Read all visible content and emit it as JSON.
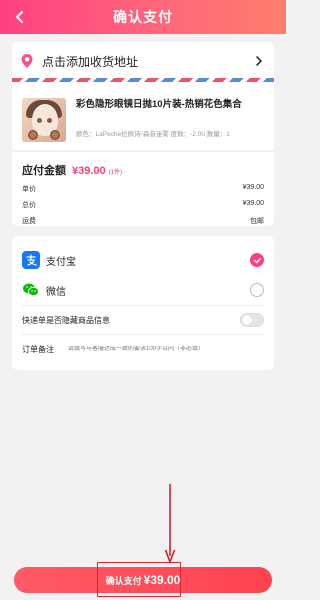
{
  "header": {
    "title": "确认支付"
  },
  "address": {
    "label": "点击添加收货地址"
  },
  "product": {
    "name": "彩色隐形眼镜日抛10片装-热销花色集合",
    "spec": "颜色：LaPeche拉佩诗-森音迷雾  度数：-2.00  数量：1"
  },
  "price": {
    "due_label": "应付金额",
    "due_amount": "¥39.00",
    "due_count": "(1件)",
    "rows": [
      {
        "label": "单价",
        "value": "¥39.00"
      },
      {
        "label": "总价",
        "value": "¥39.00"
      },
      {
        "label": "运费",
        "value": "包邮"
      }
    ]
  },
  "payment": {
    "alipay_label": "支付宝",
    "alipay_selected": true,
    "wechat_label": "微信",
    "wechat_selected": false,
    "hide_label": "快递单是否隐藏商品信息",
    "hide_enabled": false,
    "note_label": "订单备注",
    "note_placeholder": "请填写与客服达成一致的要求100字以内（非必填）"
  },
  "footer": {
    "pay_label": "确认支付",
    "pay_amount": "¥39.00"
  },
  "colors": {
    "accent": "#ff3f82",
    "price": "#ff3f6e",
    "alipay": "#1677ff",
    "wechat": "#09bb07",
    "button": "#ff4a57"
  }
}
